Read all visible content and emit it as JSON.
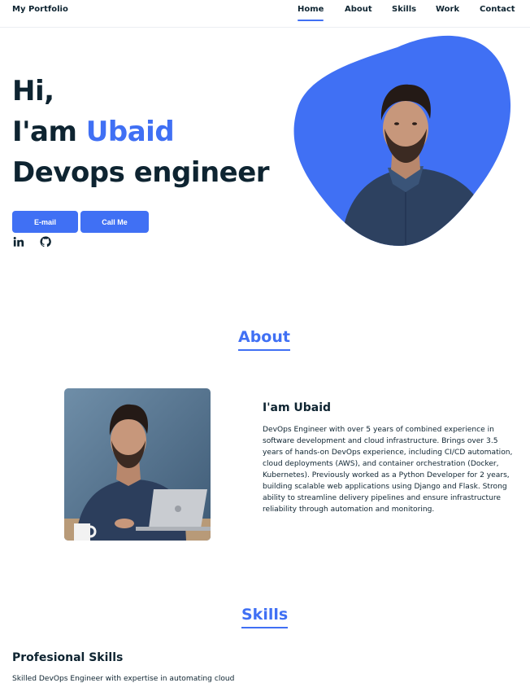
{
  "header": {
    "logo": "My Portfolio",
    "nav": [
      {
        "label": "Home",
        "active": true
      },
      {
        "label": "About",
        "active": false
      },
      {
        "label": "Skills",
        "active": false
      },
      {
        "label": "Work",
        "active": false
      },
      {
        "label": "Contact",
        "active": false
      }
    ]
  },
  "hero": {
    "line1": "Hi,",
    "line2_prefix": "I'am ",
    "line2_name": "Ubaid",
    "line3": "Devops engineer",
    "email_label": "E-mail",
    "call_label": "Call Me",
    "socials": [
      "linkedin-icon",
      "github-icon"
    ]
  },
  "about": {
    "title": "About",
    "name": "I'am Ubaid",
    "text": "DevOps Engineer with over 5 years of combined experience in software development and cloud infrastructure. Brings over 3.5 years of hands-on DevOps experience, including CI/CD automation, cloud deployments (AWS), and container orchestration (Docker, Kubernetes). Previously worked as a Python Developer for 2 years, building scalable web applications using Django and Flask. Strong ability to streamline delivery pipelines and ensure infrastructure reliability through automation and monitoring."
  },
  "skills": {
    "title": "Skills",
    "subtitle": "Profesional Skills",
    "text": "Skilled DevOps Engineer with expertise in automating cloud"
  },
  "colors": {
    "accent": "#4070f4",
    "text": "#0e2431",
    "background": "#ffffff"
  }
}
